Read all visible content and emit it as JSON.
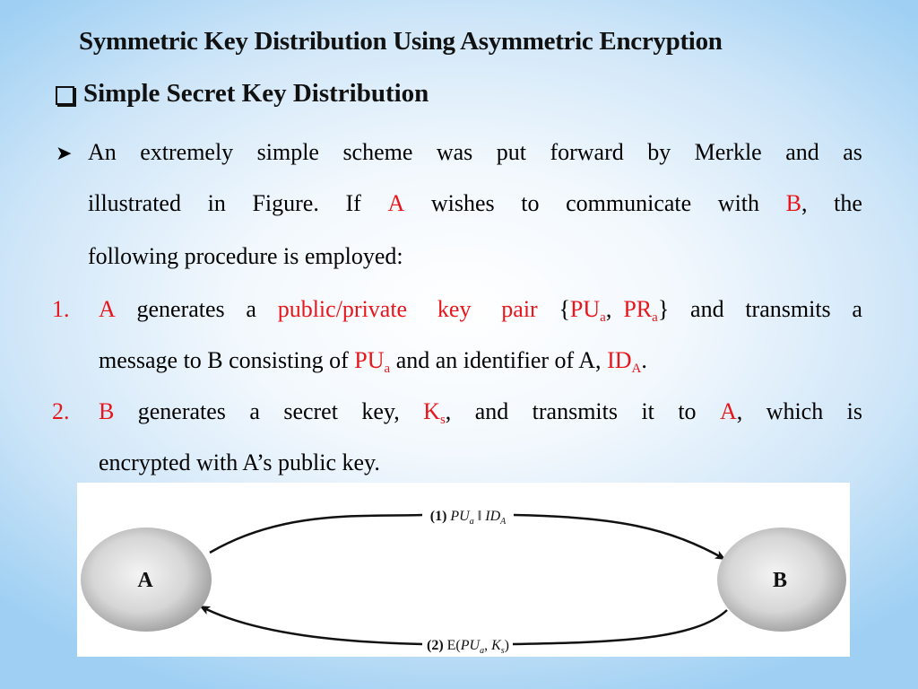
{
  "slide": {
    "title": "Symmetric Key Distribution Using Asymmetric Encryption",
    "subtitle": "Simple Secret Key Distribution",
    "intro": {
      "bullet_icon": "arrow-bullet-icon",
      "line1_words": [
        "An",
        "extremely",
        "simple",
        "scheme",
        "was",
        "put",
        "forward",
        "by",
        "Merkle",
        "and",
        "as"
      ],
      "line2_words": [
        "illustrated",
        "in",
        "Figure.",
        "If",
        "A",
        "wishes",
        "to",
        "communicate",
        "with",
        "B,",
        "the"
      ],
      "line3": "following procedure is employed:"
    },
    "steps": [
      {
        "number": "1.",
        "line1": {
          "a": "A",
          "t1": "generates",
          "t2": "a",
          "keypair": "public/private key pair",
          "brace_open": "{",
          "pu": "PU",
          "pu_sub": "a",
          "comma": ",",
          "pr": "PR",
          "pr_sub": "a",
          "brace_close": "}",
          "t3": "and",
          "t4": "transmits",
          "t5": "a"
        },
        "line2": {
          "t1": "message to B consisting of ",
          "pu": "PU",
          "pu_sub": "a",
          "t2": " and an identifier of A, ",
          "id": "ID",
          "id_sub": "A",
          "t3": "."
        }
      },
      {
        "number": "2.",
        "line1": {
          "b": "B",
          "t1": "generates",
          "t2": "a",
          "t3": "secret",
          "t4": "key,",
          "ks": "K",
          "ks_sub": "s",
          "t5": ",",
          "t6": "and",
          "t7": "transmits",
          "t8": "it",
          "t9": "to",
          "a": "A",
          "t10": ",",
          "t11": "which",
          "t12": "is"
        },
        "line2": "encrypted with A’s public key."
      }
    ],
    "diagram": {
      "node_a": "A",
      "node_b": "B",
      "msg1": {
        "num": "(1)",
        "pu": "PU",
        "pu_sub": "a",
        "sep": " ‖ ",
        "id": "ID",
        "id_sub": "A"
      },
      "msg2": {
        "num": "(2)",
        "e": " E(",
        "pu": "PU",
        "pu_sub": "a",
        "comma": ", ",
        "k": "K",
        "k_sub": "s",
        "close": ")"
      }
    },
    "colors": {
      "highlight": "#e8161b",
      "text": "#111111"
    }
  }
}
